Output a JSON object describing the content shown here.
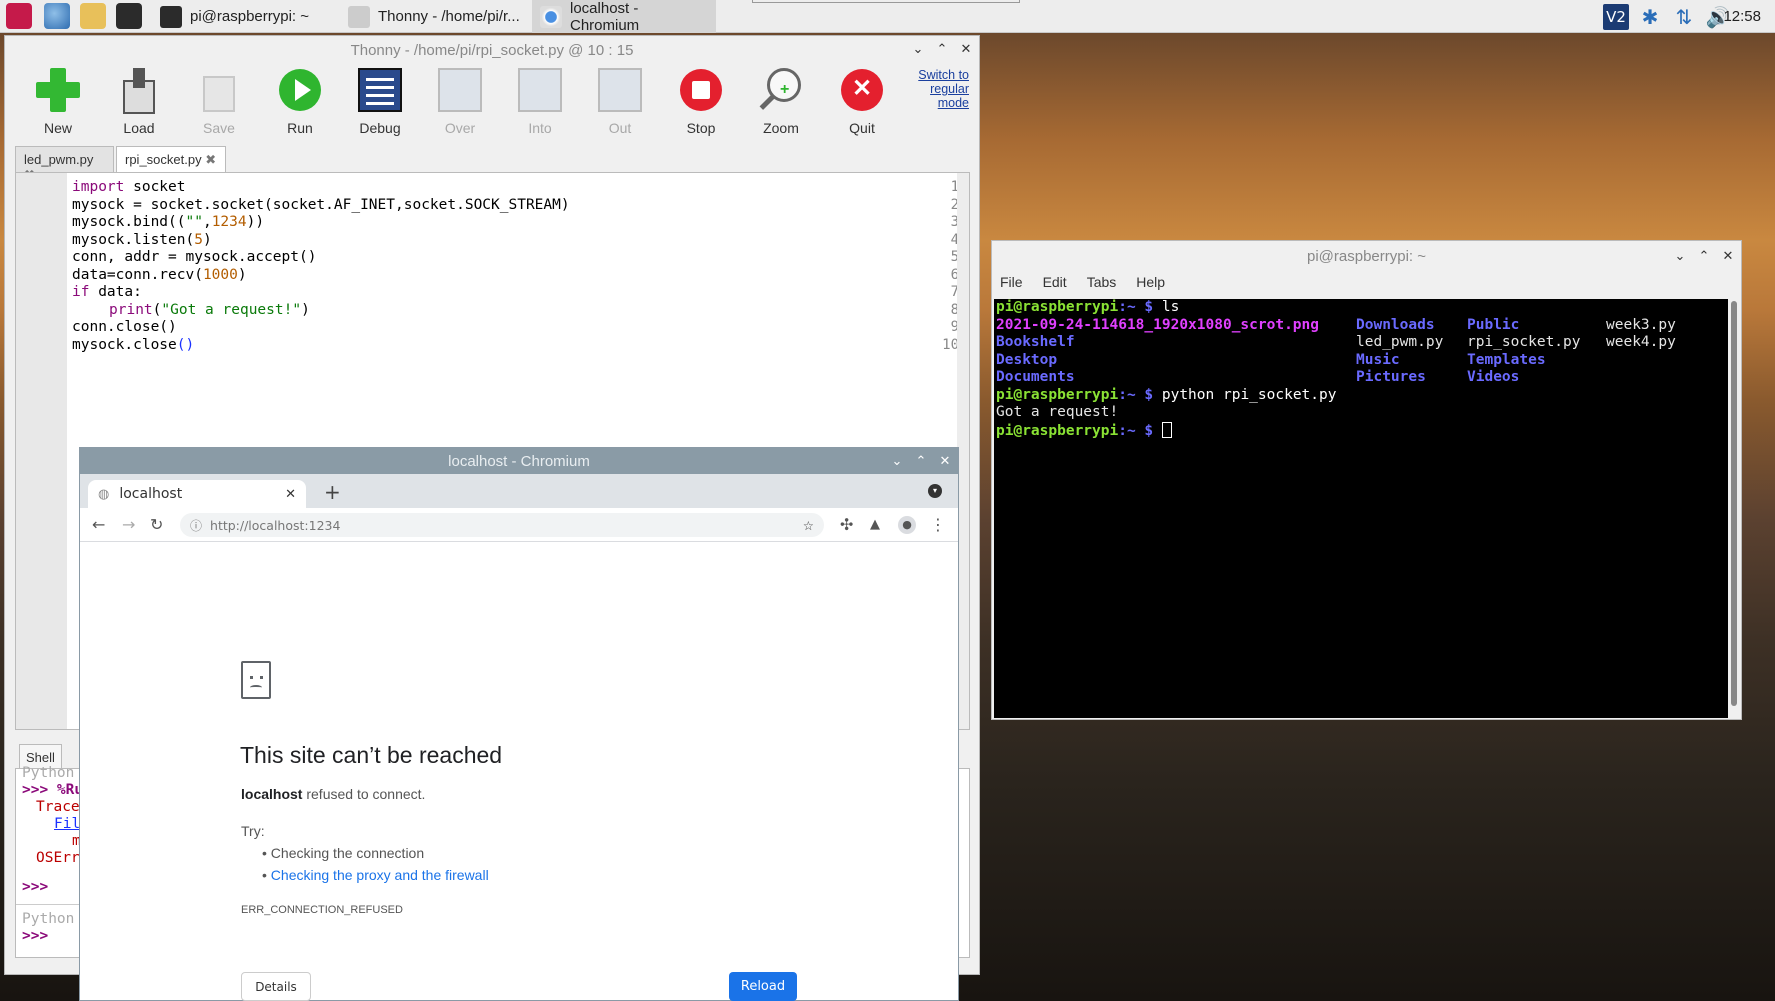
{
  "taskbar": {
    "tasks": [
      {
        "label": "pi@raspberrypi: ~"
      },
      {
        "label": "Thonny  -  /home/pi/r..."
      },
      {
        "label": "localhost - Chromium"
      }
    ],
    "clock": "12:58"
  },
  "thonny": {
    "title": "Thonny  -  /home/pi/rpi_socket.py  @  10 : 15",
    "toolbar": [
      {
        "label": "New",
        "icon": "new-icon",
        "enabled": true
      },
      {
        "label": "Load",
        "icon": "load-icon",
        "enabled": true
      },
      {
        "label": "Save",
        "icon": "save-icon",
        "enabled": false
      },
      {
        "label": "Run",
        "icon": "run-icon",
        "enabled": true
      },
      {
        "label": "Debug",
        "icon": "debug-icon",
        "enabled": true
      },
      {
        "label": "Over",
        "icon": "step-over-icon",
        "enabled": false
      },
      {
        "label": "Into",
        "icon": "step-into-icon",
        "enabled": false
      },
      {
        "label": "Out",
        "icon": "step-out-icon",
        "enabled": false
      },
      {
        "label": "Stop",
        "icon": "stop-icon",
        "enabled": true
      },
      {
        "label": "Zoom",
        "icon": "zoom-icon",
        "enabled": true
      },
      {
        "label": "Quit",
        "icon": "quit-icon",
        "enabled": true
      }
    ],
    "switch_mode": "Switch to regular mode",
    "tabs": [
      "led_pwm.py",
      "rpi_socket.py"
    ],
    "code_lines": [
      "1",
      "2",
      "3",
      "4",
      "5",
      "6",
      "7",
      "8",
      "9",
      "10"
    ],
    "shell_tab": "Shell",
    "shell_lines": [
      "Python",
      ">>> %Ru",
      "Trace",
      "Fil",
      "m",
      "OSErr",
      ">>>",
      "Python",
      ">>>"
    ]
  },
  "code": {
    "l1_kw": "import",
    "l1_rest": " socket",
    "l2": "mysock = socket.socket(socket.AF_INET,socket.SOCK_STREAM)",
    "l3_a": "mysock.bind((",
    "l3_s": "\"\"",
    "l3_c": ",",
    "l3_n": "1234",
    "l3_e": "))",
    "l4_a": "mysock.listen(",
    "l4_n": "5",
    "l4_e": ")",
    "l5": "conn, addr = mysock.accept()",
    "l6_a": "data=conn.recv(",
    "l6_n": "1000",
    "l6_e": ")",
    "l7_kw": "if",
    "l7_rest": " data:",
    "l8_kw": "print",
    "l8_a": "(",
    "l8_s": "\"Got a request!\"",
    "l8_e": ")",
    "l9": "conn.close()",
    "l10_a": "mysock.close",
    "l10_p": "()"
  },
  "chromium": {
    "title": "localhost - Chromium",
    "tab_label": "localhost",
    "url": "http://localhost:1234",
    "error_title": "This site can’t be reached",
    "error_host": "localhost",
    "error_msg": " refused to connect.",
    "try_label": "Try:",
    "suggestion1": "Checking the connection",
    "suggestion2": "Checking the proxy and the firewall",
    "error_code": "ERR_CONNECTION_REFUSED",
    "details_btn": "Details",
    "reload_btn": "Reload"
  },
  "terminal": {
    "title": "pi@raspberrypi: ~",
    "menu": [
      "File",
      "Edit",
      "Tabs",
      "Help"
    ],
    "prompt": "pi@raspberrypi",
    "prompt_path": ":~ $",
    "cmd1": " ls",
    "ls_col1": [
      "2021-09-24-114618_1920x1080_scrot.png",
      "Bookshelf",
      "Desktop",
      "Documents"
    ],
    "ls_col2": [
      "Downloads",
      "led_pwm.py",
      "Music",
      "Pictures"
    ],
    "ls_col3": [
      "Public",
      "rpi_socket.py",
      "Templates",
      "Videos"
    ],
    "ls_col4": [
      "week3.py",
      "week4.py"
    ],
    "cmd2": " python rpi_socket.py",
    "output": "Got a request!"
  },
  "colors": {
    "accent": "#1a73e8",
    "prompt_green": "#8ae234",
    "dir_blue": "#6a6aff"
  }
}
